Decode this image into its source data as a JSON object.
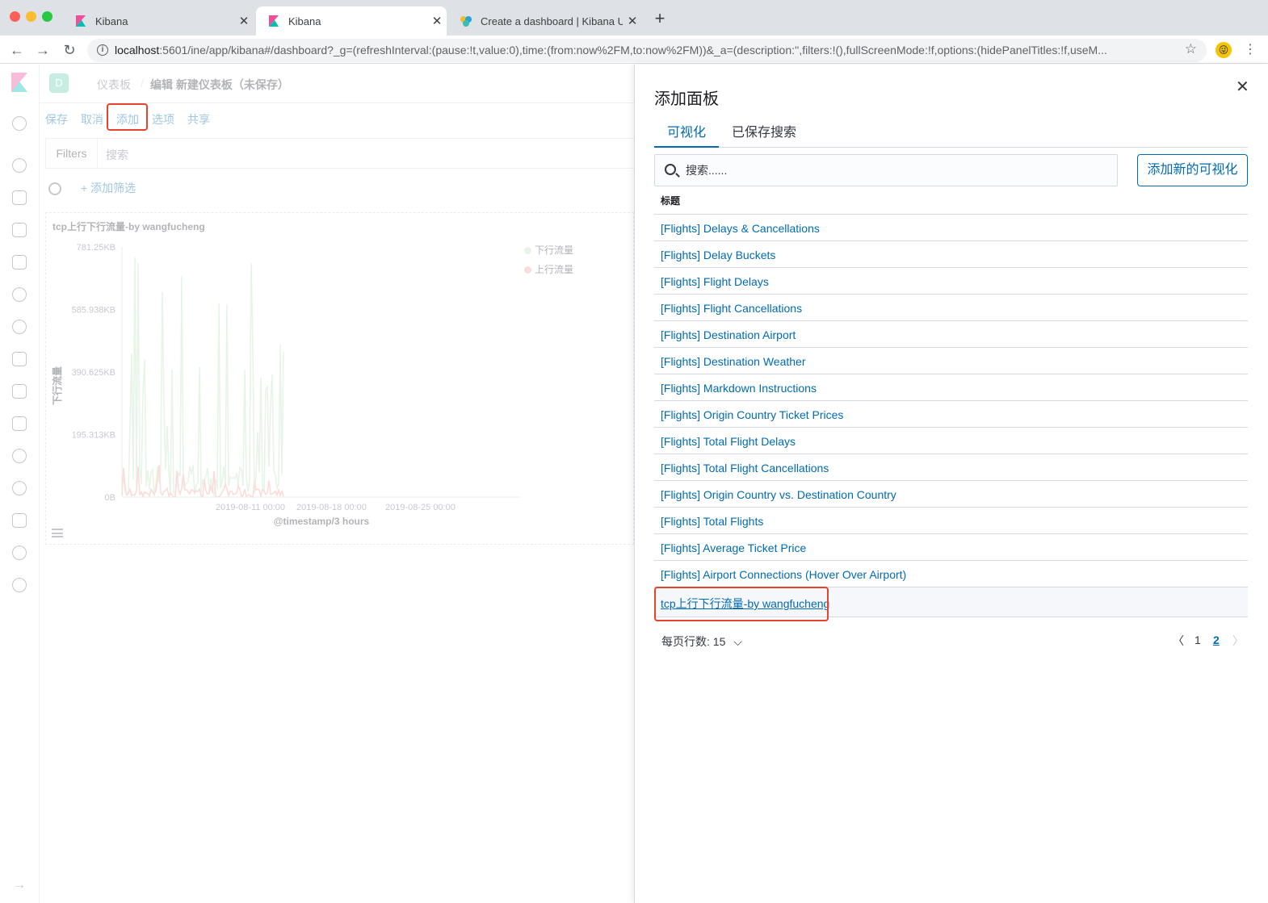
{
  "browser": {
    "tabs": [
      {
        "title": "Kibana",
        "active": false
      },
      {
        "title": "Kibana",
        "active": true
      },
      {
        "title": "Create a dashboard | Kibana U",
        "active": false
      }
    ],
    "url_host": "localhost",
    "url_rest": ":5601/ine/app/kibana#/dashboard?_g=(refreshInterval:(pause:!t,value:0),time:(from:now%2FM,to:now%2FM))&_a=(description:'',filters:!(),fullScreenMode:!f,options:(hidePanelTitles:!f,useM..."
  },
  "kibana": {
    "space_letter": "D",
    "breadcrumb": {
      "root": "仪表板",
      "current": "编辑 新建仪表板（未保存）"
    },
    "menu": {
      "save": "保存",
      "cancel": "取消",
      "add": "添加",
      "options": "选项",
      "share": "共享"
    },
    "filters": {
      "label": "Filters",
      "search_placeholder": "搜索",
      "add_filter": "+ 添加筛选"
    },
    "panel": {
      "title": "tcp上行下行流量-by wangfucheng"
    }
  },
  "chart_data": {
    "type": "line",
    "title": "tcp上行下行流量-by wangfucheng",
    "xlabel": "@timestamp/3 hours",
    "ylabel": "下行流量",
    "y_ticks": [
      "0B",
      "195.313KB",
      "390.625KB",
      "585.938KB",
      "781.25KB"
    ],
    "x_ticks": [
      "2019-08-11 00:00",
      "2019-08-18 00:00",
      "2019-08-25 00:00"
    ],
    "series": [
      {
        "name": "下行流量",
        "color": "#bfe3c1"
      },
      {
        "name": "上行流量",
        "color": "#f3a39a"
      }
    ]
  },
  "flyout": {
    "title": "添加面板",
    "tabs": [
      "可视化",
      "已保存搜索"
    ],
    "search_placeholder": "搜索......",
    "add_new_button": "添加新的可视化",
    "column_header": "标题",
    "items": [
      "[Flights] Delays & Cancellations",
      "[Flights] Delay Buckets",
      "[Flights] Flight Delays",
      "[Flights] Flight Cancellations",
      "[Flights] Destination Airport",
      "[Flights] Destination Weather",
      "[Flights] Markdown Instructions",
      "[Flights] Origin Country Ticket Prices",
      "[Flights] Total Flight Delays",
      "[Flights] Total Flight Cancellations",
      "[Flights] Origin Country vs. Destination Country",
      "[Flights] Total Flights",
      "[Flights] Average Ticket Price",
      "[Flights] Airport Connections (Hover Over Airport)",
      "tcp上行下行流量-by wangfucheng"
    ],
    "rows_per_page": "每页行数: 15",
    "pages": [
      "1",
      "2"
    ],
    "current_page": "2"
  },
  "colors": {
    "accent": "#006bb4",
    "highlight": "#e5432c"
  }
}
